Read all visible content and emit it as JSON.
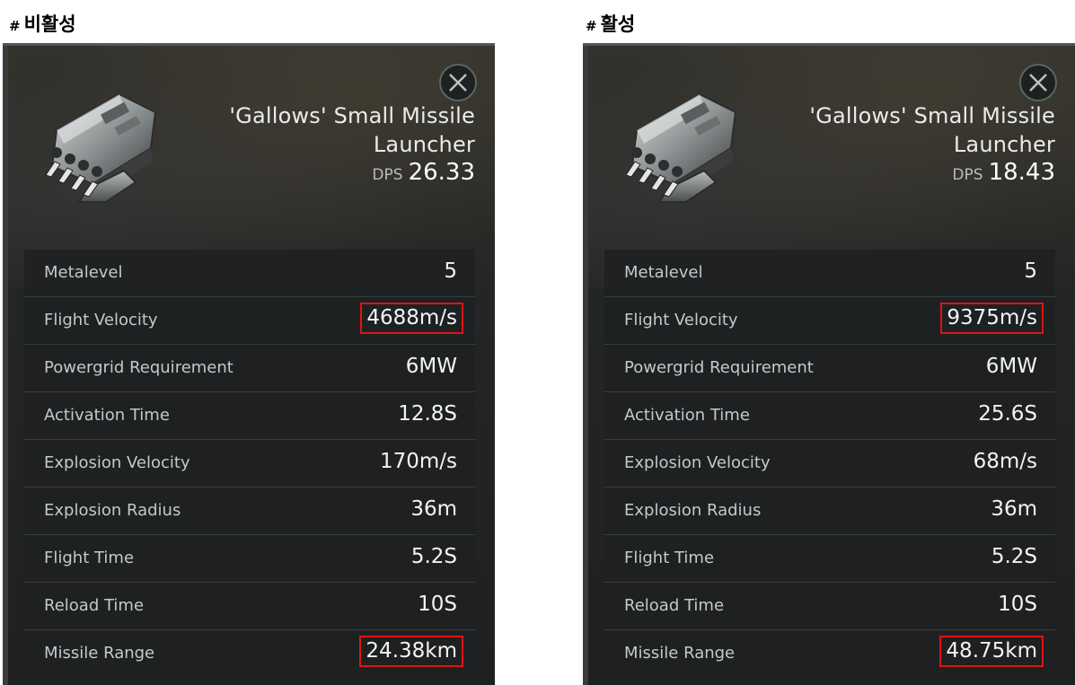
{
  "panels": [
    {
      "label_hash": "#",
      "label": "비활성",
      "item_name": "'Gallows' Small Missile Launcher",
      "dps_label": "DPS",
      "dps_value": "26.33",
      "stats": [
        {
          "label": "Metalevel",
          "value": "5",
          "highlight": false
        },
        {
          "label": "Flight Velocity",
          "value": "4688m/s",
          "highlight": true
        },
        {
          "label": "Powergrid Requirement",
          "value": "6MW",
          "highlight": false
        },
        {
          "label": "Activation Time",
          "value": "12.8S",
          "highlight": false
        },
        {
          "label": "Explosion Velocity",
          "value": "170m/s",
          "highlight": false
        },
        {
          "label": "Explosion Radius",
          "value": "36m",
          "highlight": false
        },
        {
          "label": "Flight Time",
          "value": "5.2S",
          "highlight": false
        },
        {
          "label": "Reload Time",
          "value": "10S",
          "highlight": false
        },
        {
          "label": "Missile Range",
          "value": "24.38km",
          "highlight": true
        }
      ]
    },
    {
      "label_hash": "#",
      "label": "활성",
      "item_name": "'Gallows' Small Missile Launcher",
      "dps_label": "DPS",
      "dps_value": "18.43",
      "stats": [
        {
          "label": "Metalevel",
          "value": "5",
          "highlight": false
        },
        {
          "label": "Flight Velocity",
          "value": "9375m/s",
          "highlight": true
        },
        {
          "label": "Powergrid Requirement",
          "value": "6MW",
          "highlight": false
        },
        {
          "label": "Activation Time",
          "value": "25.6S",
          "highlight": false
        },
        {
          "label": "Explosion Velocity",
          "value": "68m/s",
          "highlight": false
        },
        {
          "label": "Explosion Radius",
          "value": "36m",
          "highlight": false
        },
        {
          "label": "Flight Time",
          "value": "5.2S",
          "highlight": false
        },
        {
          "label": "Reload Time",
          "value": "10S",
          "highlight": false
        },
        {
          "label": "Missile Range",
          "value": "48.75km",
          "highlight": true
        }
      ]
    }
  ],
  "icons": {
    "close": "close-icon",
    "item": "missile-launcher-icon"
  },
  "colors": {
    "highlight_border": "#e01414",
    "panel_bg": "#242627",
    "text": "#e9ecec"
  }
}
